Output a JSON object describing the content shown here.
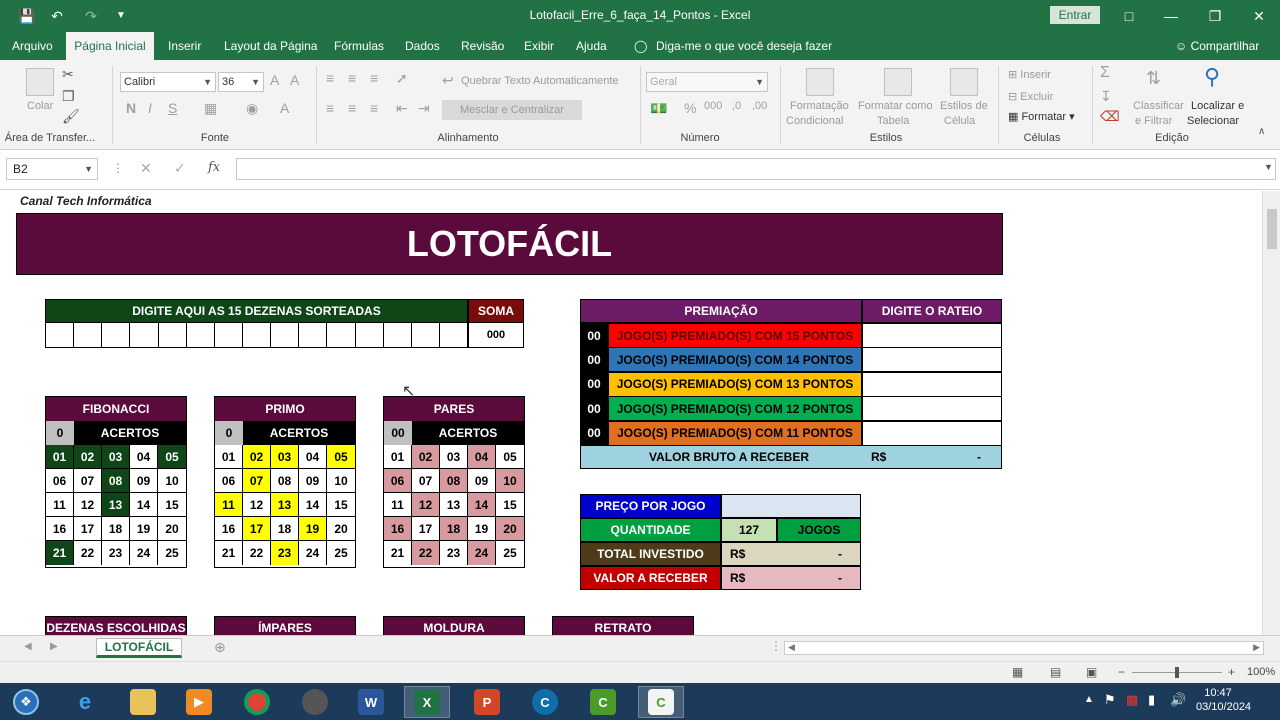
{
  "window": {
    "title": "Lotofacil_Erre_6_faça_14_Pontos  -  Excel",
    "signin_label": "Entrar"
  },
  "menu": {
    "tabs": [
      "Arquivo",
      "Página Inicial",
      "Inserir",
      "Layout da Página",
      "Fórmulas",
      "Dados",
      "Revisão",
      "Exibir",
      "Ajuda"
    ],
    "tell_me": "Diga-me o que você deseja fazer",
    "share": "Compartilhar"
  },
  "ribbon": {
    "paste": "Colar",
    "clipboard_group": "Área de Transfer...",
    "font_name": "Calibri",
    "font_size": "36",
    "font_buttons": [
      "N",
      "I",
      "S"
    ],
    "font_group": "Fonte",
    "wrap_text": "Quebrar Texto Automaticamente",
    "merge_center": "Mesclar e Centralizar",
    "alignment_group": "Alinhamento",
    "number_format": "Geral",
    "number_group": "Número",
    "cond_format": [
      "Formatação",
      "Condicional"
    ],
    "format_table": [
      "Formatar como",
      "Tabela"
    ],
    "cell_styles": [
      "Estilos de",
      "Célula"
    ],
    "styles_group": "Estilos",
    "insert": "Inserir",
    "delete": "Excluir",
    "format": "Formatar",
    "cells_group": "Células",
    "sort_filter": [
      "Classificar",
      "e Filtrar"
    ],
    "find_select": [
      "Localizar e",
      "Selecionar"
    ],
    "editing_group": "Edição"
  },
  "formula_bar": {
    "name_box": "B2",
    "fx": "fx",
    "content": ""
  },
  "sheet": {
    "credit": "Canal Tech Informática",
    "main_title": "LOTOFÁCIL",
    "entry_header": "DIGITE AQUI AS 15 DEZENAS SORTEADAS",
    "soma_header": "SOMA",
    "soma_value": "000",
    "grids": [
      {
        "title": "FIBONACCI",
        "count": "0",
        "acertos": "ACERTOS",
        "style": "fib-on",
        "highlight": [
          "01",
          "02",
          "03",
          "05",
          "08",
          "13",
          "21"
        ]
      },
      {
        "title": "PRIMO",
        "count": "0",
        "acertos": "ACERTOS",
        "style": "pri-on",
        "highlight": [
          "02",
          "03",
          "05",
          "07",
          "11",
          "13",
          "17",
          "19",
          "23"
        ]
      },
      {
        "title": "PARES",
        "count": "00",
        "acertos": "ACERTOS",
        "style": "par-on",
        "highlight": [
          "02",
          "04",
          "06",
          "08",
          "10",
          "12",
          "14",
          "16",
          "18",
          "20",
          "22",
          "24"
        ]
      }
    ],
    "numbers": [
      "01",
      "02",
      "03",
      "04",
      "05",
      "06",
      "07",
      "08",
      "09",
      "10",
      "11",
      "12",
      "13",
      "14",
      "15",
      "16",
      "17",
      "18",
      "19",
      "20",
      "21",
      "22",
      "23",
      "24",
      "25"
    ],
    "prize": {
      "header": "PREMIAÇÃO",
      "rateio_header": "DIGITE O RATEIO",
      "rows": [
        {
          "count": "00",
          "label": "JOGO(S) PREMIADO(S) COM 15 PONTOS",
          "color": "#ff0000",
          "text_color": "#5b0000"
        },
        {
          "count": "00",
          "label": "JOGO(S) PREMIADO(S) COM 14 PONTOS",
          "color": "#2e75b6",
          "text_color": "#000"
        },
        {
          "count": "00",
          "label": "JOGO(S) PREMIADO(S) COM 13 PONTOS",
          "color": "#ffc000",
          "text_color": "#000"
        },
        {
          "count": "00",
          "label": "JOGO(S) PREMIADO(S) COM 12 PONTOS",
          "color": "#00b050",
          "text_color": "#000"
        },
        {
          "count": "00",
          "label": "JOGO(S) PREMIADO(S) COM 11 PONTOS",
          "color": "#e07020",
          "text_color": "#000"
        }
      ],
      "gross_label": "VALOR BRUTO A RECEBER",
      "gross_currency": "R$",
      "gross_value": "-"
    },
    "summary": {
      "price_label": "PREÇO POR JOGO",
      "qty_label": "QUANTIDADE",
      "qty_value": "127",
      "qty_unit": "JOGOS",
      "invested_label": "TOTAL INVESTIDO",
      "invested_currency": "R$",
      "invested_value": "-",
      "receive_label": "VALOR A RECEBER",
      "receive_currency": "R$",
      "receive_value": "-"
    },
    "bottom_headers": [
      "DEZENAS ESCOLHIDAS",
      "ÍMPARES",
      "MOLDURA",
      "RETRATO"
    ]
  },
  "sheet_tab": "LOTOFÁCIL",
  "status": {
    "zoom": "100%"
  },
  "taskbar": {
    "time": "10:47",
    "date": "03/10/2024"
  }
}
